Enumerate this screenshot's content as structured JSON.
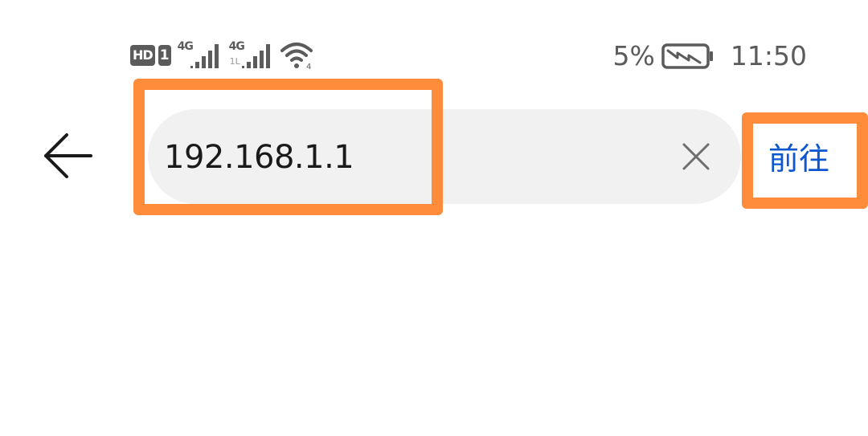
{
  "status_bar": {
    "hd_label": "HD",
    "sim_label": "1",
    "network_1": {
      "type": "4G",
      "icon": "signal-bars-icon"
    },
    "network_2": {
      "type": "4G",
      "sub": "1L",
      "icon": "signal-bars-icon"
    },
    "wifi": {
      "icon": "wifi-icon",
      "badge": "4"
    },
    "battery_percent": "5%",
    "battery_icon": "battery-charging-icon",
    "time": "11:50"
  },
  "address_bar": {
    "back_icon": "back-arrow-icon",
    "url_value": "192.168.1.1",
    "clear_icon": "close-icon",
    "go_label": "前往"
  },
  "colors": {
    "field_background": "#f1f1f1",
    "go_text": "#0b57d0",
    "highlight": "#ff8c3b",
    "status_text": "#5b5b5b"
  }
}
